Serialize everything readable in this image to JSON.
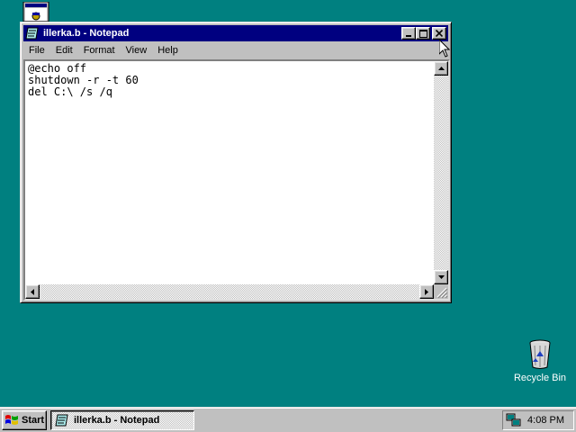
{
  "window": {
    "title": "illerka.b - Notepad",
    "menu": [
      "File",
      "Edit",
      "Format",
      "View",
      "Help"
    ],
    "lines": [
      "@echo off",
      "shutdown -r -t 60",
      "del C:\\ /s /q"
    ],
    "controls": {
      "minimize_icon": "minimize-icon",
      "maximize_icon": "maximize-icon",
      "close_icon": "close-icon"
    }
  },
  "desktop": {
    "icons": [
      {
        "name": "Recycle Bin",
        "icon": "recycle-bin-icon"
      }
    ],
    "background_color": "#008080"
  },
  "taskbar": {
    "start_label": "Start",
    "tasks": [
      {
        "label": "illerka.b - Notepad",
        "icon": "notepad-icon",
        "active": true
      }
    ],
    "clock": "4:08 PM",
    "tray_icon": "network-icon"
  },
  "colors": {
    "title_active": "#000080",
    "face": "#c0c0c0"
  }
}
